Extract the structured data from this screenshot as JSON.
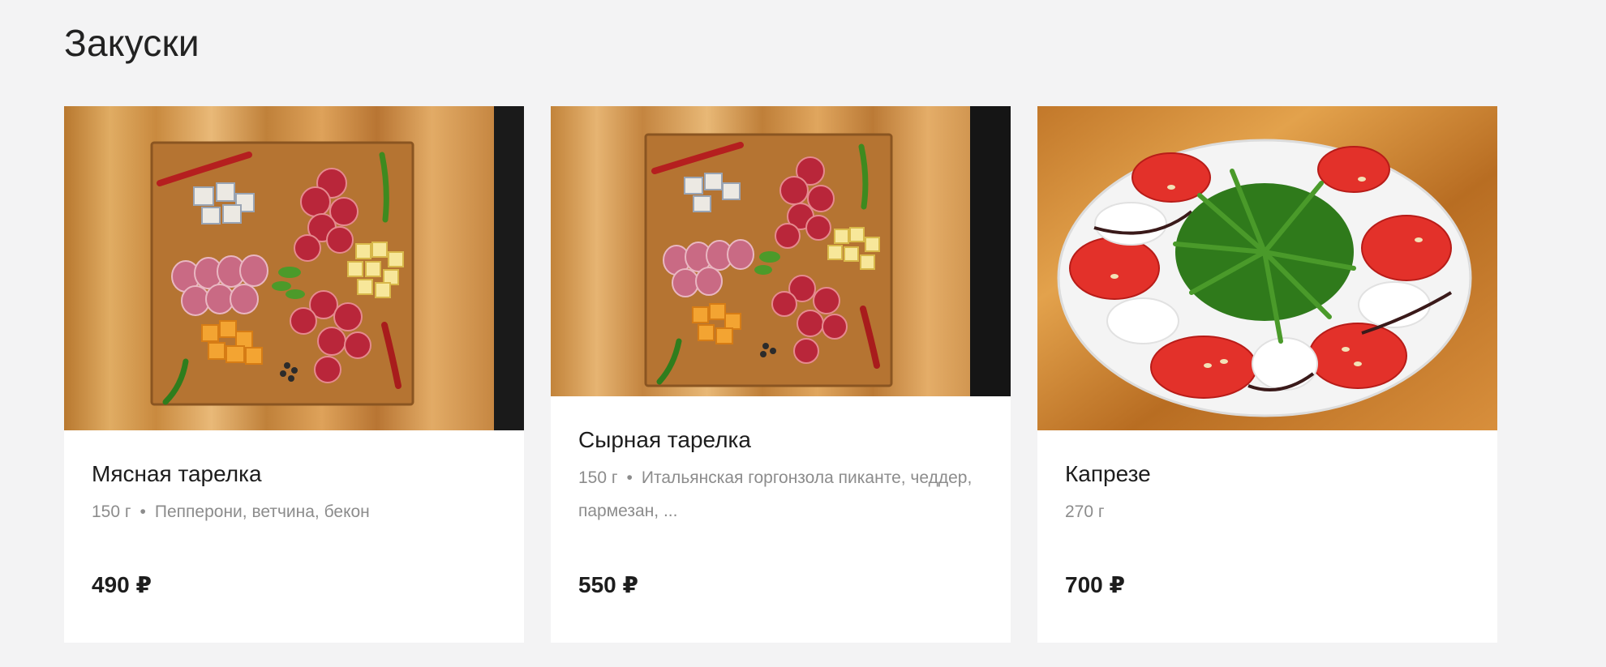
{
  "section": {
    "title": "Закуски"
  },
  "cards": [
    {
      "image": "meat-board-photo",
      "name": "Мясная тарелка",
      "weight": "150 г",
      "separator": "•",
      "description": "Пепперони, ветчина, бекон",
      "price": "490 ₽"
    },
    {
      "image": "cheese-board-photo",
      "name": "Сырная тарелка",
      "weight": "150 г",
      "separator": "•",
      "description": "Итальянская горгонзола пиканте, чеддер, пармезан, ...",
      "price": "550 ₽"
    },
    {
      "image": "caprese-plate-photo",
      "name": "Капрезе",
      "weight": "270 г",
      "price": "700 ₽"
    }
  ],
  "colors": {
    "page_background": "#f3f3f4",
    "card_background": "#ffffff",
    "text_primary": "#1d1d1d",
    "text_secondary": "#8c8c8c"
  }
}
